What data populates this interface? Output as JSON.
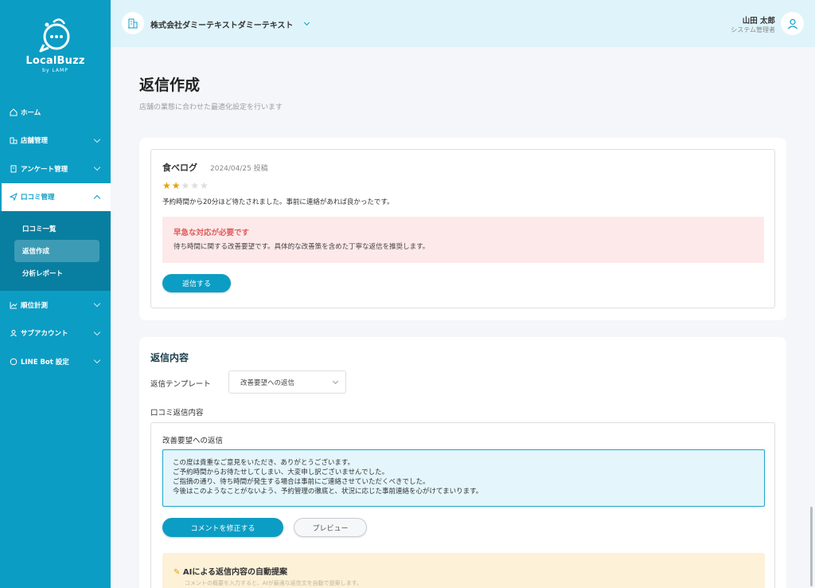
{
  "brand": {
    "name": "LocalBuzz",
    "sub": "by LAMP"
  },
  "sidebar": {
    "items": [
      {
        "label": "ホーム",
        "icon": "home-icon"
      },
      {
        "label": "店舗管理",
        "icon": "store-icon"
      },
      {
        "label": "アンケート管理",
        "icon": "survey-icon"
      },
      {
        "label": "口コミ管理",
        "icon": "send-icon"
      },
      {
        "label": "順位計測",
        "icon": "chart-icon"
      },
      {
        "label": "サブアカウント",
        "icon": "user-icon"
      },
      {
        "label": "LINE Bot 設定",
        "icon": "chat-icon"
      }
    ],
    "subitems": [
      {
        "label": "口コミ一覧"
      },
      {
        "label": "返信作成"
      },
      {
        "label": "分析レポート"
      }
    ]
  },
  "header": {
    "company": "株式会社ダミーテキストダミーテキスト",
    "user_name": "山田 太郎",
    "user_role": "システム管理者"
  },
  "page": {
    "title": "返信作成",
    "subtitle": "店舗の業態に合わせた最適化設定を行います"
  },
  "review": {
    "source": "食べログ",
    "date": "2024/04/25 投稿",
    "rating": 2,
    "max_rating": 5,
    "text": "予約時間から20分ほど待たされました。事前に連絡があれば良かったです。",
    "alert_title": "早急な対応が必要です",
    "alert_text": "待ち時間に関する改善要望です。具体的な改善策を含めた丁寧な返信を推奨します。",
    "reply_button": "返信する"
  },
  "reply": {
    "section_title": "返信内容",
    "template_label": "返信テンプレート",
    "template_value": "改善要望への返信",
    "content_label": "口コミ返信内容",
    "reply_heading": "改善要望への返信",
    "lines": [
      "この度は貴重なご意見をいただき、ありがとうございます。",
      "ご予約時間からお待たせしてしまい、大変申し訳ございませんでした。",
      "ご指摘の通り、待ち時間が発生する場合は事前にご連絡させていただくべきでした。",
      "今後はこのようなことがないよう、予約管理の徹底と、状況に応じた事前連絡を心がけてまいります。"
    ],
    "edit_button": "コメントを修正する",
    "preview_button": "プレビュー",
    "ai_title": "AIによる返信内容の自動提案",
    "ai_sub": "コメントの概要を入力すると、AIが最適な返信文を自動で提案します。"
  },
  "colors": {
    "accent": "#0c9dc4",
    "alert_bg": "#fde9ea",
    "alert_text": "#e05a5a",
    "ai_bg": "#fdf1d8"
  }
}
